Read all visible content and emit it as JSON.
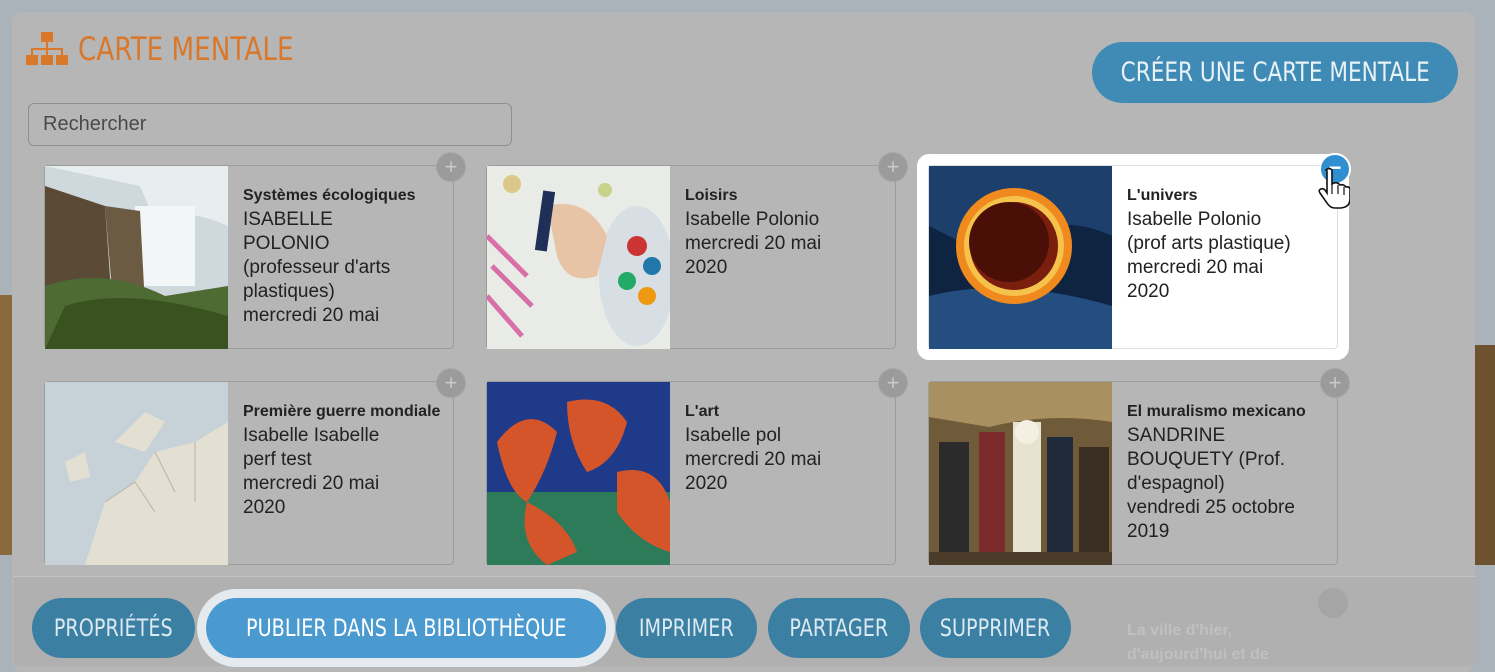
{
  "header": {
    "title": "CARTE MENTALE",
    "title_icon": "sitemap-icon",
    "create_label": "CRÉER UNE CARTE MENTALE"
  },
  "search": {
    "placeholder": "Rechercher"
  },
  "cards": [
    {
      "title": "Systèmes écologiques",
      "lines": [
        "ISABELLE",
        "POLONIO",
        "(professeur d'arts",
        "plastiques)",
        "mercredi 20 mai"
      ],
      "image": "waterfall"
    },
    {
      "title": "Loisirs",
      "lines": [
        "Isabelle Polonio",
        "mercredi 20 mai",
        "2020"
      ],
      "image": "crayons"
    },
    {
      "title": "L'univers",
      "lines": [
        "Isabelle Polonio",
        "(prof arts plastique)",
        "mercredi 20 mai",
        "2020"
      ],
      "image": "eclipse",
      "selected": true
    },
    {
      "title": "Première guerre mondiale",
      "lines": [
        "Isabelle Isabelle",
        "perf test",
        "mercredi 20 mai",
        "2020"
      ],
      "image": "map"
    },
    {
      "title": "L'art",
      "lines": [
        "Isabelle pol",
        "mercredi 20 mai",
        "2020"
      ],
      "image": "dance"
    },
    {
      "title": "El muralismo mexicano",
      "lines": [
        "SANDRINE",
        "BOUQUETY (Prof.",
        "d'espagnol)",
        "vendredi 25 octobre",
        "2019"
      ],
      "image": "mural"
    }
  ],
  "card_controls": {
    "add_symbol": "+",
    "remove_symbol": "−"
  },
  "partial_card": {
    "title": "La ville d'hier, d'aujourd'hui et de"
  },
  "actions": {
    "properties": "PROPRIÉTÉS",
    "publish": "PUBLIER DANS LA BIBLIOTHÈQUE",
    "print": "IMPRIMER",
    "share": "PARTAGER",
    "delete": "SUPPRIMER"
  },
  "colors": {
    "accent_orange": "#d9772b",
    "button_blue": "#3f8bb5",
    "selected_badge": "#2f8fd0"
  }
}
